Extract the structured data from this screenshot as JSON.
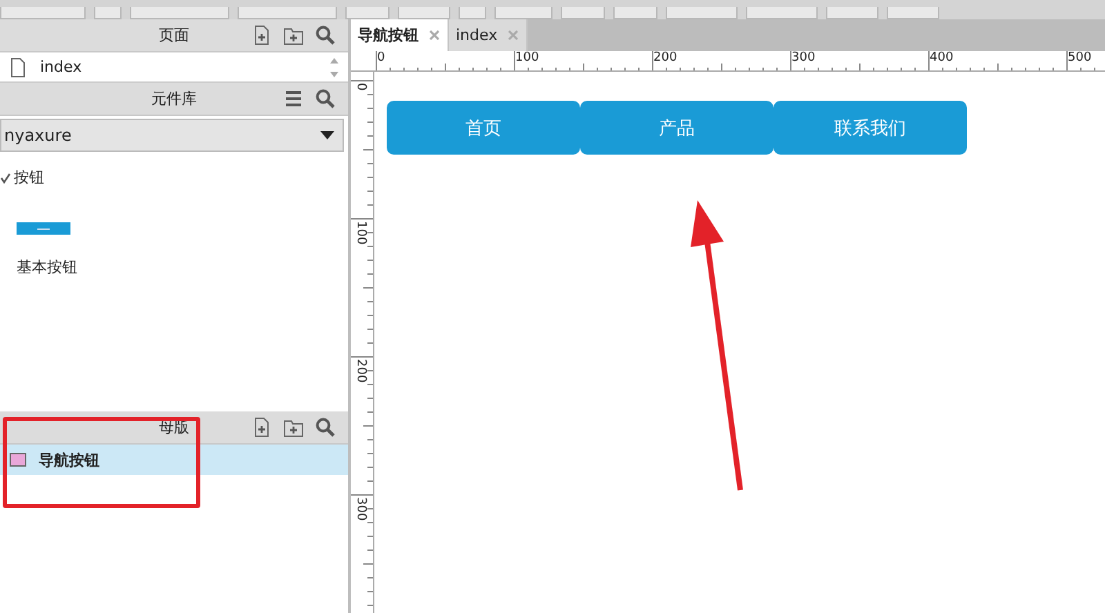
{
  "pages_panel": {
    "title": "页面",
    "items": [
      {
        "label": "index"
      }
    ]
  },
  "library_panel": {
    "title": "元件库",
    "library": "nyaxure",
    "groups": [
      {
        "label": "按钮",
        "expanded": true,
        "widgets": [
          {
            "label": "基本按钮"
          }
        ]
      }
    ]
  },
  "masters_panel": {
    "title": "母版",
    "items": [
      {
        "label": "导航按钮",
        "selected": true
      }
    ]
  },
  "tabs": [
    {
      "label": "导航按钮",
      "selected": true
    },
    {
      "label": "index",
      "selected": false
    }
  ],
  "ruler": {
    "horizontal": [
      "0",
      "100",
      "200",
      "300",
      "400",
      "500"
    ],
    "vertical": [
      "0",
      "100",
      "200",
      "300"
    ]
  },
  "canvas": {
    "buttons": [
      {
        "label": "首页"
      },
      {
        "label": "产品"
      },
      {
        "label": "联系我们"
      }
    ]
  },
  "annotations": {
    "highlight_box": true,
    "arrow": true
  }
}
